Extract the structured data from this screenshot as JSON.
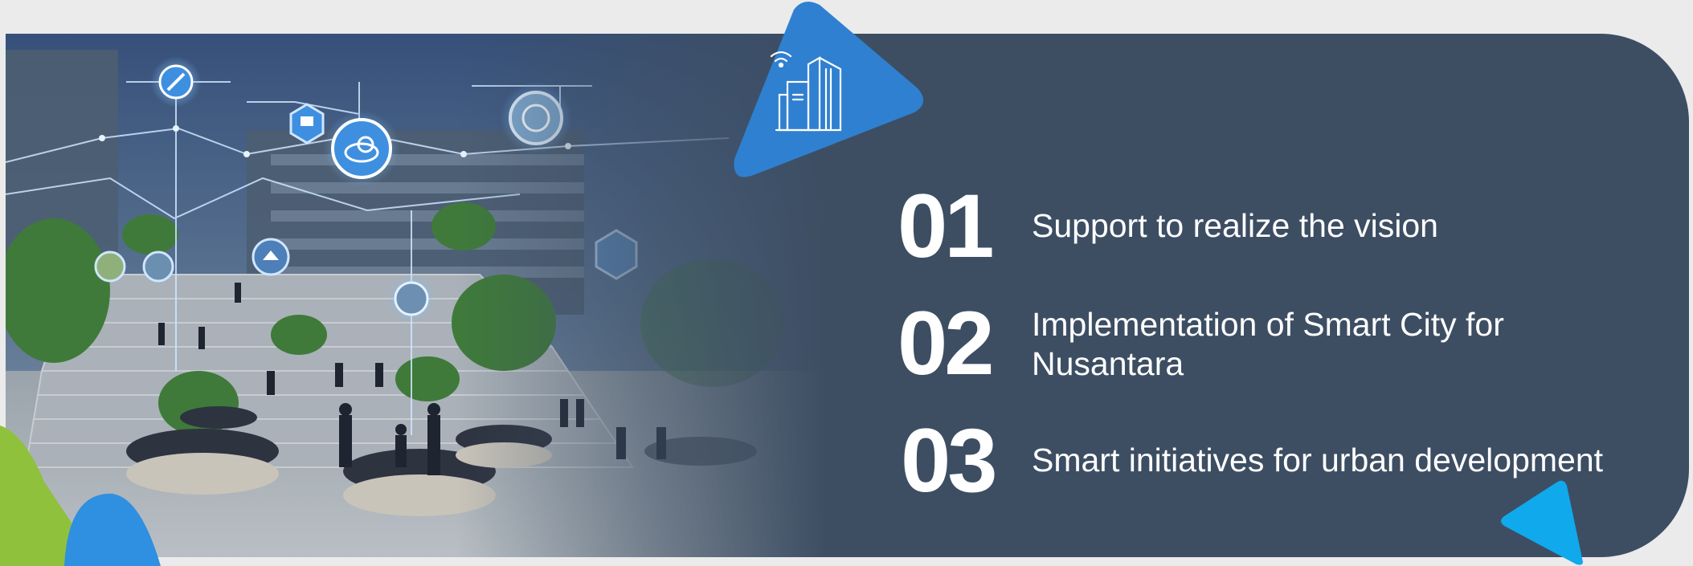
{
  "colors": {
    "banner": "#3d4e63",
    "background": "#ebebeb",
    "accent_blue": "#2f80d0",
    "accent_cyan": "#10a9ec",
    "accent_green": "#8fc13d",
    "text": "#ffffff"
  },
  "illustration": {
    "description_icon_names": [
      "satellite-icon",
      "cart-icon",
      "cloud-icon",
      "brain-icon",
      "home-icon",
      "box-icon",
      "wifi-icon",
      "chat-icon"
    ]
  },
  "badge": {
    "icon": "smart-building-icon"
  },
  "items": [
    {
      "number": "01",
      "text": "Support to realize the vision"
    },
    {
      "number": "02",
      "text": "Implementation of Smart City for Nusantara"
    },
    {
      "number": "03",
      "text": "Smart initiatives for urban development"
    }
  ]
}
